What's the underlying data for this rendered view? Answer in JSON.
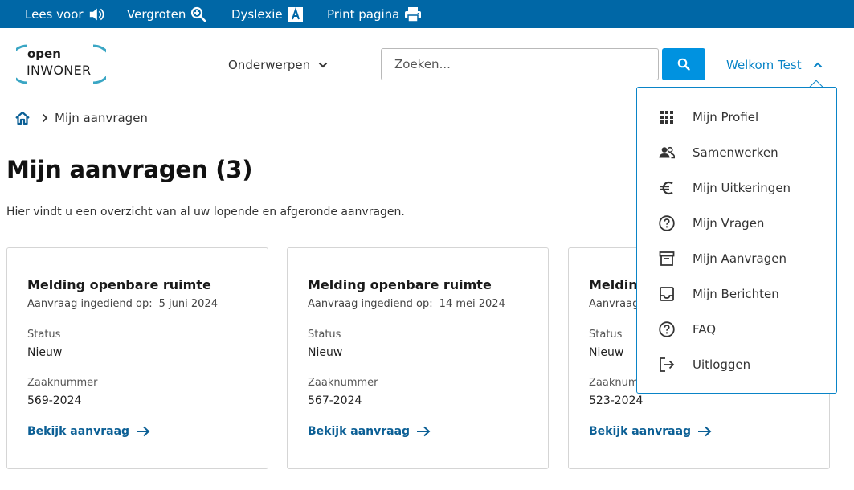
{
  "accessibility_bar": {
    "read_aloud": "Lees voor",
    "enlarge": "Vergroten",
    "dyslexia": "Dyslexie",
    "print": "Print pagina"
  },
  "header": {
    "logo_text_top": "open",
    "logo_text_bottom": "INWONER",
    "nav_subjects": "Onderwerpen",
    "search_placeholder": "Zoeken...",
    "user_greeting": "Welkom Test"
  },
  "breadcrumb": {
    "current": "Mijn aanvragen"
  },
  "main": {
    "title": "Mijn aanvragen (3)",
    "intro": "Hier vindt u een overzicht van al uw lopende en afgeronde aanvragen."
  },
  "cards": [
    {
      "title": "Melding openbare ruimte",
      "submitted_label": "Aanvraag ingediend op:",
      "submitted_date": "5 juni 2024",
      "status_label": "Status",
      "status_value": "Nieuw",
      "case_label": "Zaaknummer",
      "case_value": "569-2024",
      "link_label": "Bekijk aanvraag"
    },
    {
      "title": "Melding openbare ruimte",
      "submitted_label": "Aanvraag ingediend op:",
      "submitted_date": "14 mei 2024",
      "status_label": "Status",
      "status_value": "Nieuw",
      "case_label": "Zaaknummer",
      "case_value": "567-2024",
      "link_label": "Bekijk aanvraag"
    },
    {
      "title": "Melding",
      "submitted_label": "Aanvraag",
      "submitted_date": "",
      "status_label": "Status",
      "status_value": "Nieuw",
      "case_label": "Zaaknumm",
      "case_value": "523-2024",
      "link_label": "Bekijk aanvraag"
    }
  ],
  "user_menu": {
    "items": [
      {
        "label": "Mijn Profiel",
        "icon": "grid-icon"
      },
      {
        "label": "Samenwerken",
        "icon": "people-icon"
      },
      {
        "label": "Mijn Uitkeringen",
        "icon": "euro-icon"
      },
      {
        "label": "Mijn Vragen",
        "icon": "question-circle-icon"
      },
      {
        "label": "Mijn Aanvragen",
        "icon": "archive-icon"
      },
      {
        "label": "Mijn Berichten",
        "icon": "inbox-icon"
      },
      {
        "label": "FAQ",
        "icon": "question-circle-icon"
      },
      {
        "label": "Uitloggen",
        "icon": "logout-icon"
      }
    ]
  },
  "colors": {
    "topbar": "#0067a6",
    "accent": "#0a84c7",
    "search_button": "#0092e0",
    "link": "#0b5f95",
    "logo_teal": "#3aa6c4"
  }
}
